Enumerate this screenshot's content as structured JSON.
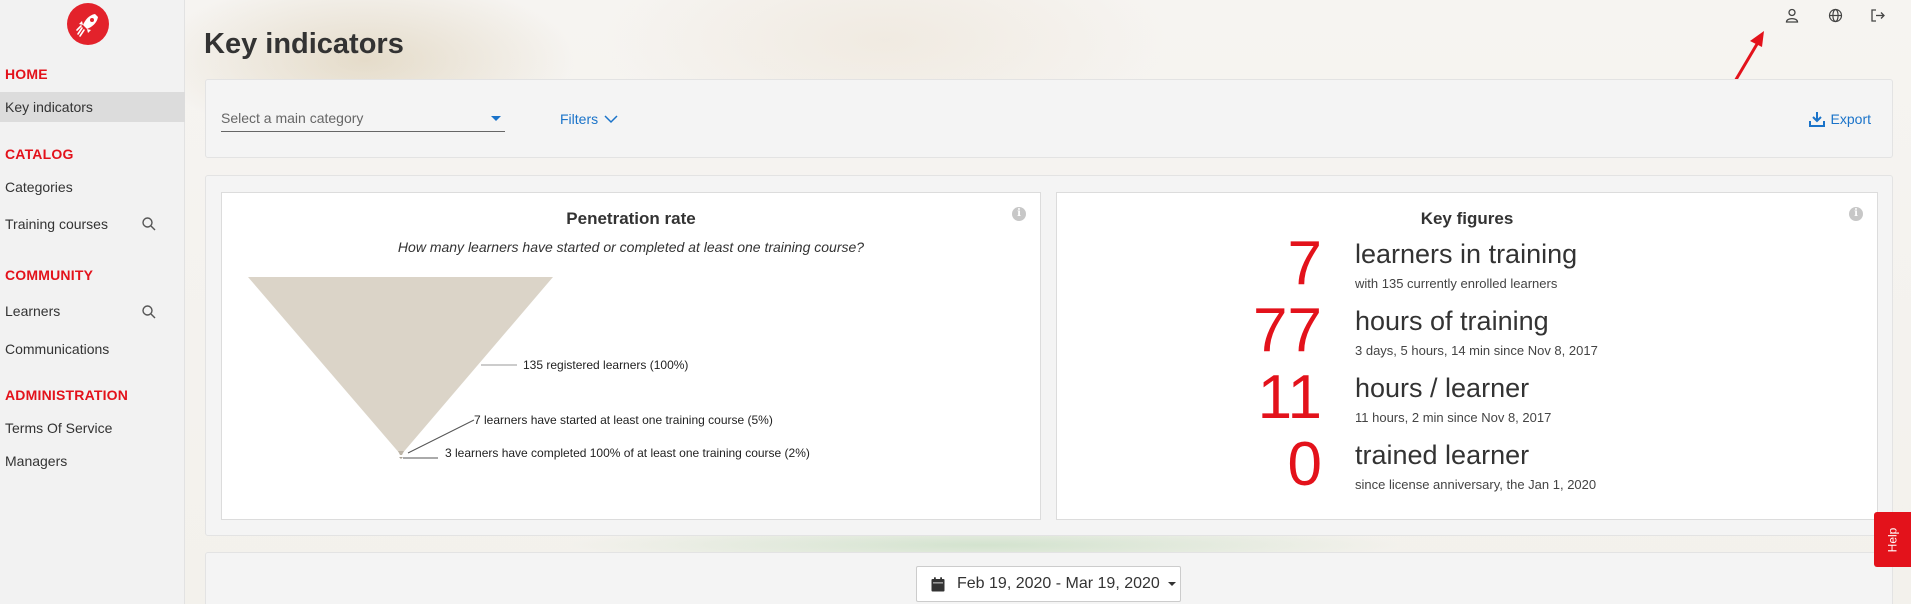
{
  "sidebar": {
    "sections": [
      {
        "title": "HOME",
        "items": [
          {
            "label": "Key indicators"
          }
        ]
      },
      {
        "title": "CATALOG",
        "items": [
          {
            "label": "Categories"
          },
          {
            "label": "Training courses"
          }
        ]
      },
      {
        "title": "COMMUNITY",
        "items": [
          {
            "label": "Learners"
          },
          {
            "label": "Communications"
          }
        ]
      },
      {
        "title": "ADMINISTRATION",
        "items": [
          {
            "label": "Terms Of Service"
          },
          {
            "label": "Managers"
          }
        ]
      }
    ]
  },
  "header": {
    "title": "Key indicators",
    "icons": [
      "user-icon",
      "globe-icon",
      "logout-icon"
    ]
  },
  "toolbar": {
    "category_placeholder": "Select a main category",
    "filters_label": "Filters",
    "export_label": "Export"
  },
  "penetration": {
    "title": "Penetration rate",
    "subtitle": "How many learners have started or completed at least one training course?",
    "levels": [
      {
        "label": "135 registered learners (100%)",
        "percent": 100
      },
      {
        "label": "7 learners have started at least one training course (5%)",
        "percent": 5
      },
      {
        "label": "3 learners have completed 100% of at least one training course (2%)",
        "percent": 2
      }
    ]
  },
  "key_figures": {
    "title": "Key figures",
    "rows": [
      {
        "value": "7",
        "label": "learners in training",
        "sub": "with 135 currently enrolled learners"
      },
      {
        "value": "77",
        "label": "hours of training",
        "sub": "3 days, 5 hours, 14 min since Nov 8, 2017"
      },
      {
        "value": "11",
        "label": "hours / learner",
        "sub": "11 hours, 2 min since Nov 8, 2017"
      },
      {
        "value": "0",
        "label": "trained learner",
        "sub": "since license anniversary, the Jan 1, 2020"
      }
    ]
  },
  "date_range": {
    "label": "Feb 19, 2020 - Mar 19, 2020"
  },
  "help": {
    "label": "Help"
  },
  "colors": {
    "accent": "#e3121b",
    "link": "#1a73c9",
    "funnel": "#dbd4c8"
  }
}
